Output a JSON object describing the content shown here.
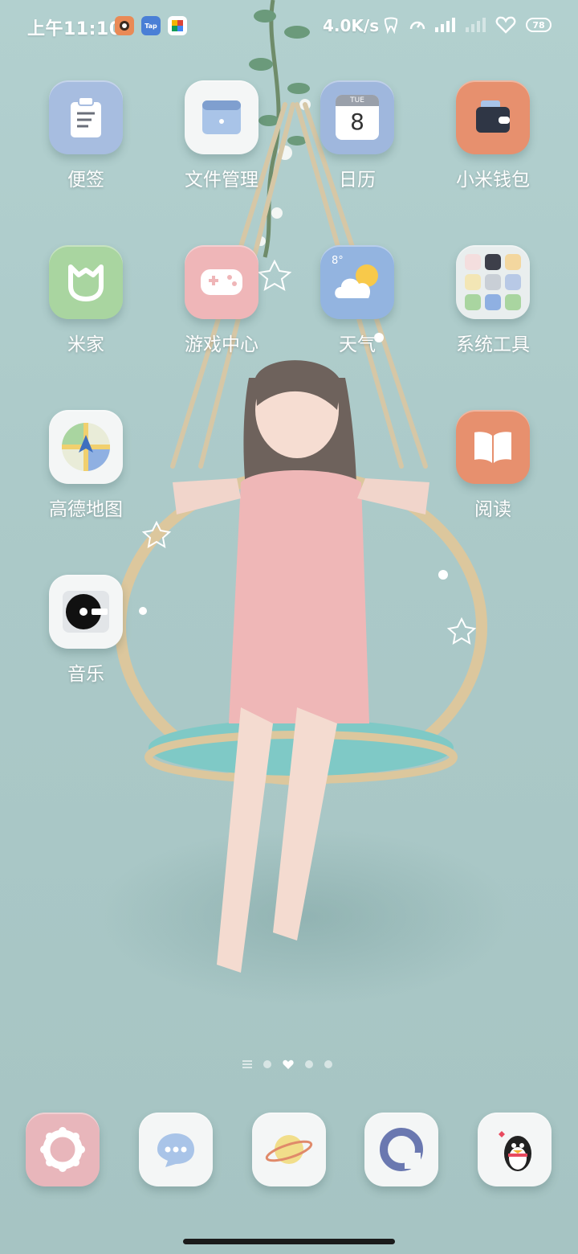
{
  "status_bar": {
    "time": "上午11:10",
    "notifications": [
      {
        "name": "game-app-notification",
        "text": ""
      },
      {
        "name": "taptap-notification",
        "text": "Tap"
      },
      {
        "name": "photo-app-notification",
        "text": ""
      }
    ],
    "network_speed": "4.0K/s",
    "battery_level": "78"
  },
  "home_screen": {
    "rows": [
      [
        {
          "label": "便签",
          "icon": "notes-icon",
          "color": "#9fb7dd"
        },
        {
          "label": "文件管理",
          "icon": "file-manager-icon",
          "color": "#f4f6f6"
        },
        {
          "label": "日历",
          "icon": "calendar-icon",
          "color": "#9fb7dd",
          "calendar_day": "TUE",
          "calendar_date": "8"
        },
        {
          "label": "小米钱包",
          "icon": "wallet-icon",
          "color": "#e7906e"
        }
      ],
      [
        {
          "label": "米家",
          "icon": "mijia-icon",
          "color": "#a9d5a0"
        },
        {
          "label": "游戏中心",
          "icon": "gamepad-icon",
          "color": "#efb6b8"
        },
        {
          "label": "天气",
          "icon": "weather-icon",
          "color": "#93b4e0",
          "temperature": "8°"
        },
        {
          "label": "系统工具",
          "icon": "folder-icon",
          "color": "#e9eeee"
        }
      ],
      [
        {
          "label": "高德地图",
          "icon": "map-icon",
          "color": "#f4f6f6"
        },
        {
          "label": "阅读",
          "icon": "book-icon",
          "color": "#e7906e"
        }
      ],
      [
        {
          "label": "音乐",
          "icon": "music-icon",
          "color": "#f4f6f6"
        }
      ]
    ]
  },
  "pager": {
    "pages": 5,
    "current": 2
  },
  "dock": [
    {
      "icon": "flower-app-icon",
      "color": "#e8b6bb"
    },
    {
      "icon": "message-icon",
      "color": "#f4f6f6"
    },
    {
      "icon": "planet-app-icon",
      "color": "#f4f6f6"
    },
    {
      "icon": "browser-icon",
      "color": "#f4f6f6"
    },
    {
      "icon": "penguin-qq-icon",
      "color": "#f4f6f6"
    }
  ]
}
